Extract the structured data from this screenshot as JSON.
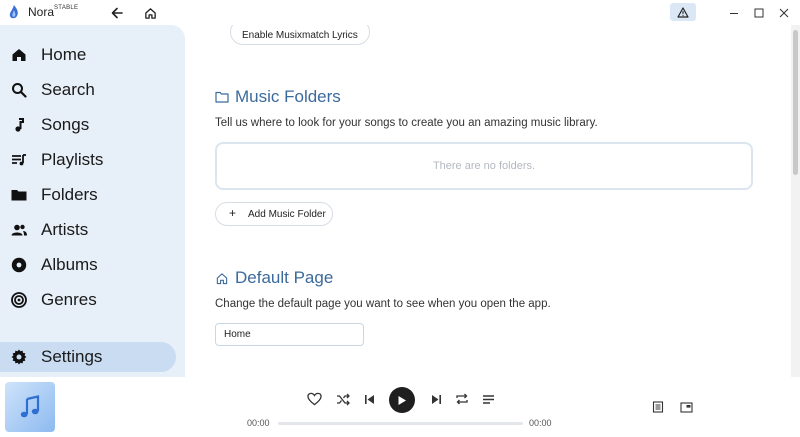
{
  "titlebar": {
    "app_name": "Nora",
    "badge": "STABLE",
    "icons": [
      "nora-logo-icon",
      "back-arrow-icon",
      "home-icon",
      "warning-icon",
      "minimize-icon",
      "maximize-icon",
      "close-icon"
    ]
  },
  "sidebar": {
    "items": [
      {
        "label": "Home",
        "icon": "home-icon"
      },
      {
        "label": "Search",
        "icon": "search-icon"
      },
      {
        "label": "Songs",
        "icon": "music-note-icon"
      },
      {
        "label": "Playlists",
        "icon": "playlist-icon"
      },
      {
        "label": "Folders",
        "icon": "folder-icon"
      },
      {
        "label": "Artists",
        "icon": "artists-icon"
      },
      {
        "label": "Albums",
        "icon": "album-icon"
      },
      {
        "label": "Genres",
        "icon": "genres-icon"
      },
      {
        "label": "Settings",
        "icon": "gear-icon",
        "active": true
      }
    ]
  },
  "settings": {
    "lyrics_button": "Enable Musixmatch Lyrics",
    "music_folders": {
      "title": "Music Folders",
      "description": "Tell us where to look for your songs to create you an amazing music library.",
      "empty_text": "There are no folders.",
      "add_button": "Add Music Folder",
      "add_icon": "+"
    },
    "default_page": {
      "title": "Default Page",
      "description": "Change the default page you want to see when you open the app.",
      "selected": "Home"
    }
  },
  "player": {
    "current_time": "00:00",
    "total_time": "00:00",
    "progress": 0,
    "controls": [
      "heart-icon",
      "shuffle-icon",
      "skip-previous-icon",
      "play-icon",
      "skip-next-icon",
      "repeat-icon",
      "queue-icon",
      "lyrics-icon",
      "mini-player-icon"
    ]
  },
  "colors": {
    "sidebar_bg": "#e7eff8",
    "active_bg": "#c9dcf2",
    "accent": "#3b6a9c"
  }
}
